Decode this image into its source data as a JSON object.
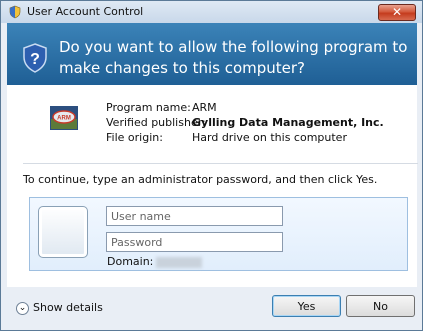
{
  "window": {
    "title": "User Account Control",
    "close_label": "✕"
  },
  "header": {
    "question": "Do you want to allow the following program to make changes to this computer?"
  },
  "program": {
    "name_label": "Program name:",
    "name_value": "ARM",
    "publisher_label": "Verified publisher:",
    "publisher_value": "Gylling Data Management, Inc.",
    "origin_label": "File origin:",
    "origin_value": "Hard drive on this computer"
  },
  "credentials": {
    "instruction": "To continue, type an administrator password, and then click Yes.",
    "username_placeholder": "User name",
    "password_placeholder": "Password",
    "domain_label": "Domain:"
  },
  "footer": {
    "details_label": "Show details",
    "yes_label": "Yes",
    "no_label": "No"
  },
  "colors": {
    "header_blue": "#2a6fa8",
    "accent": "#3c7fb1"
  }
}
